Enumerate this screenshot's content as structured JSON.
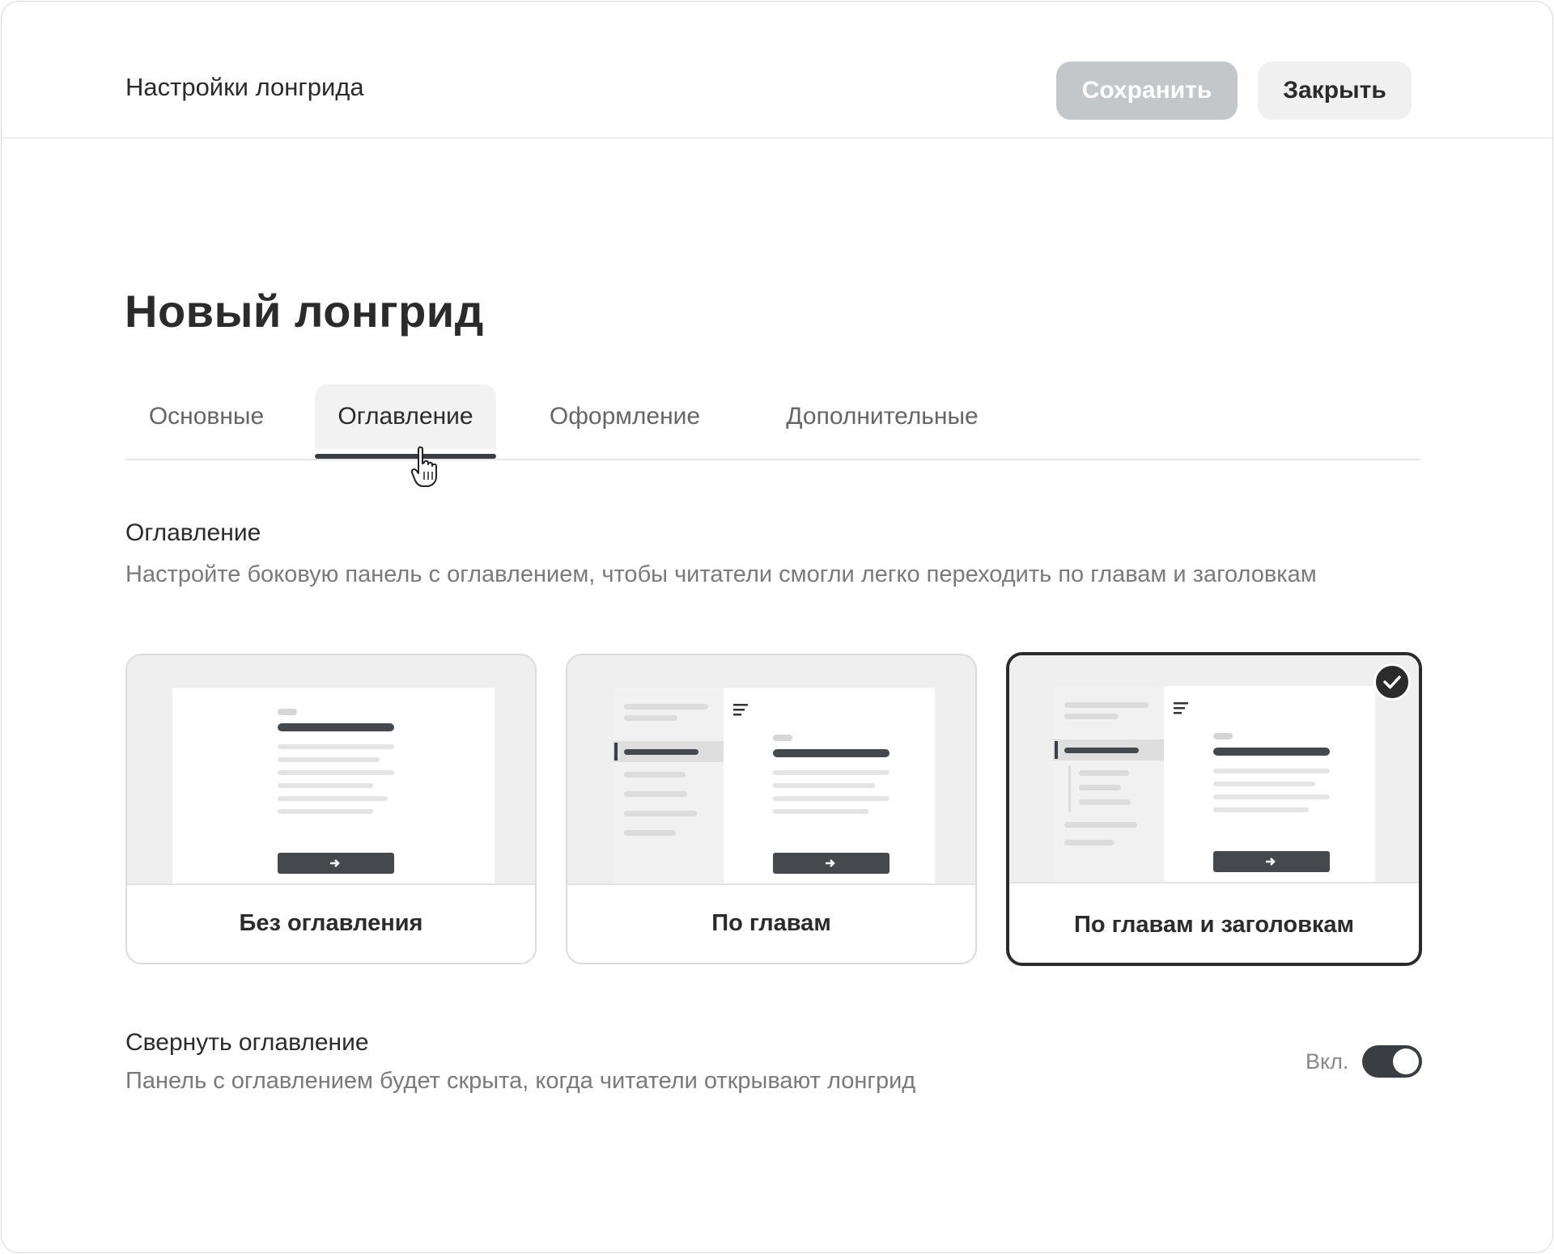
{
  "header": {
    "title": "Настройки лонгрида",
    "save_label": "Сохранить",
    "close_label": "Закрыть"
  },
  "page": {
    "title": "Новый лонгрид"
  },
  "tabs": [
    {
      "label": "Основные",
      "active": false
    },
    {
      "label": "Оглавление",
      "active": true
    },
    {
      "label": "Оформление",
      "active": false
    },
    {
      "label": "Дополнительные",
      "active": false
    }
  ],
  "toc_section": {
    "title": "Оглавление",
    "description": "Настройте боковую панель с оглавлением, чтобы читатели смогли легко переходить по главам и заголовкам",
    "options": [
      {
        "label": "Без оглавления",
        "selected": false
      },
      {
        "label": "По главам",
        "selected": false
      },
      {
        "label": "По главам и заголовкам",
        "selected": true
      }
    ]
  },
  "collapse_section": {
    "title": "Свернуть оглавление",
    "description": "Панель с оглавлением будет скрыта, когда читатели открывают лонгрид",
    "toggle_state_label": "Вкл.",
    "toggle_on": true
  },
  "colors": {
    "accent_dark": "#2b2b2b",
    "save_disabled": "#c4c7ca",
    "secondary_button": "#f0f0f0"
  }
}
